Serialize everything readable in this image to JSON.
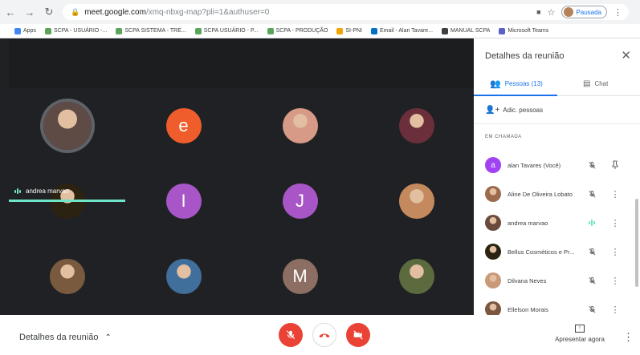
{
  "browser": {
    "url_host": "meet.google.com",
    "url_path": "/xmq-nbxg-map?pli=1&authuser=0",
    "profile_status": "Pausada",
    "bookmarks": [
      {
        "label": "Apps",
        "color": "#4285f4"
      },
      {
        "label": "SCPA - USUÁRIO -...",
        "color": "#5ba55b"
      },
      {
        "label": "SCPA SISTEMA - TRE...",
        "color": "#5ba55b"
      },
      {
        "label": "SCPA USUÁRIO - P...",
        "color": "#5ba55b"
      },
      {
        "label": "SCPA - PRODUÇÃO",
        "color": "#5ba55b"
      },
      {
        "label": "SI-PNI",
        "color": "#f4a400"
      },
      {
        "label": "Email - Alan Tavare...",
        "color": "#0072c6"
      },
      {
        "label": "MANUAL SCPA",
        "color": "#3c4043"
      },
      {
        "label": "Microsoft Teams",
        "color": "#5b5fc7"
      }
    ]
  },
  "grid": {
    "speaking_name": "andrea marvao",
    "tiles": [
      {
        "kind": "photo",
        "color": "#5e4b46",
        "ring": true
      },
      {
        "kind": "letter",
        "letter": "e",
        "color": "#ef5d2c"
      },
      {
        "kind": "photo",
        "color": "#d79a86"
      },
      {
        "kind": "photo",
        "color": "#6a2f3a"
      },
      {
        "kind": "photo",
        "color": "#2b2212"
      },
      {
        "kind": "letter",
        "letter": "I",
        "color": "#a855c8"
      },
      {
        "kind": "letter",
        "letter": "J",
        "color": "#a855c8"
      },
      {
        "kind": "photo",
        "color": "#c48a5e"
      },
      {
        "kind": "photo",
        "color": "#7a5a3f"
      },
      {
        "kind": "photo",
        "color": "#3f6f9a"
      },
      {
        "kind": "letter",
        "letter": "M",
        "color": "#8d6e63"
      },
      {
        "kind": "photo",
        "color": "#5c6b3d"
      }
    ]
  },
  "panel": {
    "title": "Detalhes da reunião",
    "tab_people": "Pessoas (13)",
    "tab_chat": "Chat",
    "add_people": "Adic. pessoas",
    "section_label": "EM CHAMADA",
    "accent": "#1a73e8",
    "participants": [
      {
        "name": "alan Tavares (Você)",
        "letter": "a",
        "color": "#a142f4",
        "mic": "muted",
        "action": "pin"
      },
      {
        "name": "Aline De Oliveira Lobato",
        "color": "#9c6b4e",
        "mic": "muted",
        "action": "more"
      },
      {
        "name": "andrea marvao",
        "color": "#6b4a3e",
        "mic": "speaking",
        "action": "more"
      },
      {
        "name": "Bellus Cosméticos e Pr...",
        "color": "#2b2212",
        "mic": "muted",
        "action": "more"
      },
      {
        "name": "Dilvana Neves",
        "color": "#c99a7a",
        "mic": "muted",
        "action": "more"
      },
      {
        "name": "Ellelson Morais",
        "color": "#7b5740",
        "mic": "muted",
        "action": "more"
      }
    ]
  },
  "bottom": {
    "details_label": "Detalhes da reunião",
    "present_label": "Apresentar agora",
    "danger_color": "#ea4335"
  }
}
